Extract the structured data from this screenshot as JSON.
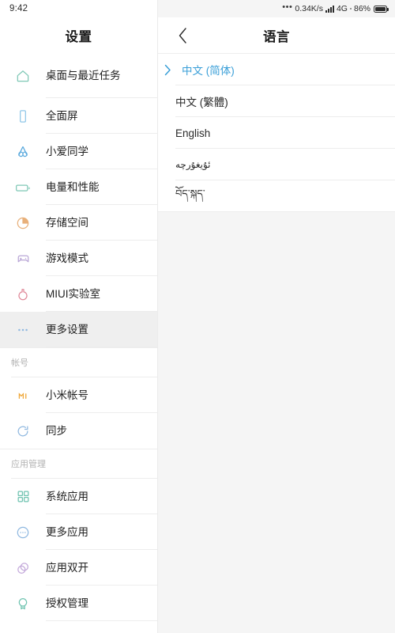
{
  "statusbar": {
    "clock": "9:42",
    "overflow_dots": "•••",
    "network_speed": "0.34K/s",
    "signal_icon": "signal-bars-icon",
    "network_type": "4G",
    "battery_percent": "86%",
    "battery_icon": "battery-icon"
  },
  "left_panel": {
    "title": "设置",
    "items": [
      {
        "label": "桌面与最近任务",
        "icon": "home-icon",
        "color": "#7fc8b6",
        "selected": false,
        "tall": true
      },
      {
        "label": "全面屏",
        "icon": "fullscreen-phone-icon",
        "color": "#8fc7e8",
        "selected": false,
        "tall": false
      },
      {
        "label": "小爱同学",
        "icon": "xiaoai-icon",
        "color": "#5aa9dd",
        "selected": false,
        "tall": false
      },
      {
        "label": "电量和性能",
        "icon": "battery-performance-icon",
        "color": "#7fc8b6",
        "selected": false,
        "tall": false
      },
      {
        "label": "存储空间",
        "icon": "storage-pie-icon",
        "color": "#e8b07a",
        "selected": false,
        "tall": false
      },
      {
        "label": "游戏模式",
        "icon": "gamepad-icon",
        "color": "#b9a6d6",
        "selected": false,
        "tall": false
      },
      {
        "label": "MIUI实验室",
        "icon": "flask-icon",
        "color": "#e08a9a",
        "selected": false,
        "tall": false
      },
      {
        "label": "更多设置",
        "icon": "more-dots-icon",
        "color": "#8fb8e0",
        "selected": true,
        "tall": false
      }
    ],
    "sections": [
      {
        "header": "帐号",
        "items": [
          {
            "label": "小米帐号",
            "icon": "mi-logo-icon",
            "color": "#f0a93c",
            "selected": false
          },
          {
            "label": "同步",
            "icon": "sync-icon",
            "color": "#8fb8e0",
            "selected": false
          }
        ]
      },
      {
        "header": "应用管理",
        "items": [
          {
            "label": "系统应用",
            "icon": "grid-apps-icon",
            "color": "#6fc3b0",
            "selected": false
          },
          {
            "label": "更多应用",
            "icon": "more-apps-icon",
            "color": "#8fb8e0",
            "selected": false
          },
          {
            "label": "应用双开",
            "icon": "dual-apps-icon",
            "color": "#c3a8da",
            "selected": false
          },
          {
            "label": "授权管理",
            "icon": "authorization-shield-icon",
            "color": "#6fc3b0",
            "selected": false
          }
        ]
      }
    ]
  },
  "right_panel": {
    "title": "语言",
    "back_icon": "chevron-left-icon",
    "accent_color": "#3a9fd8",
    "languages": [
      {
        "label": "中文 (简体)",
        "active": true,
        "chevron": "chevron-right-icon",
        "script": "han"
      },
      {
        "label": "中文 (繁體)",
        "active": false,
        "chevron": "",
        "script": "han"
      },
      {
        "label": "English",
        "active": false,
        "chevron": "",
        "script": "latin"
      },
      {
        "label": "ئۇيغۇرچە",
        "active": false,
        "chevron": "",
        "script": "arabic"
      },
      {
        "label": "བོད་སྐད་",
        "active": false,
        "chevron": "",
        "script": "tibetan"
      }
    ]
  }
}
